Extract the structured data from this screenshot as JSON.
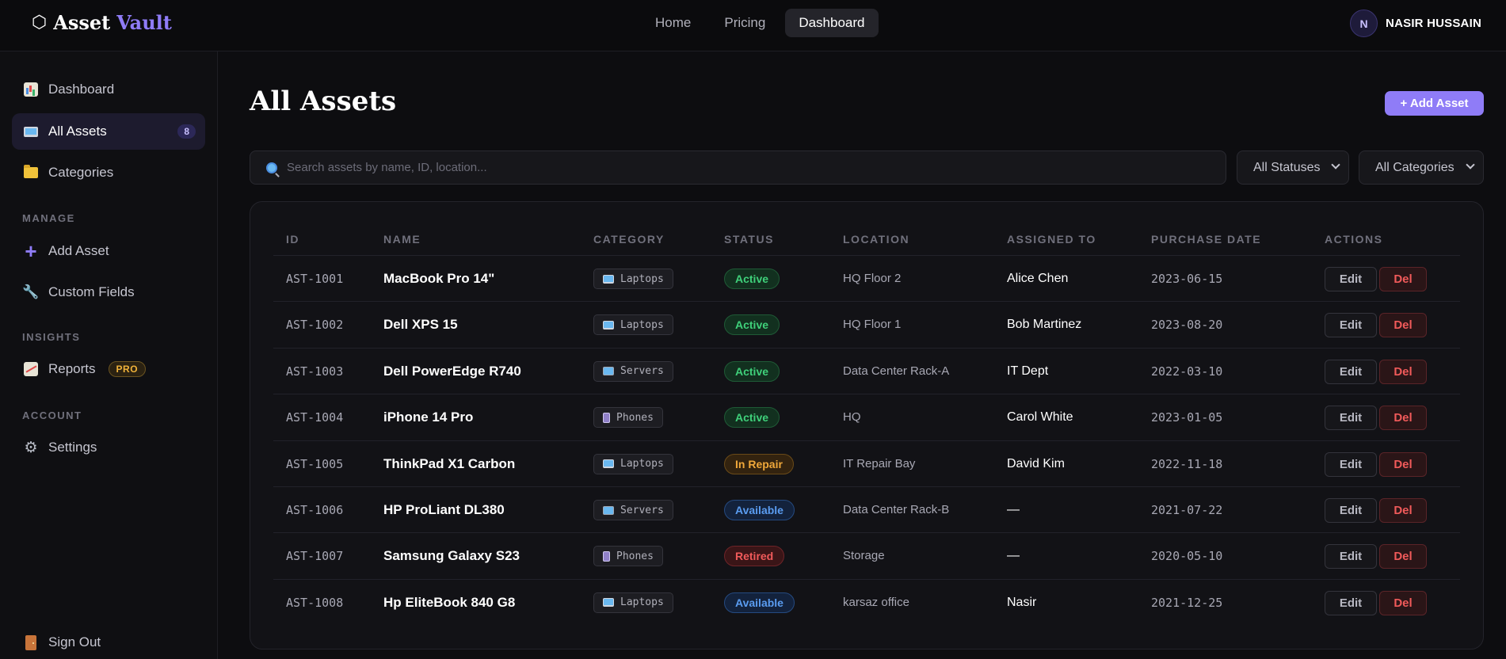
{
  "app": {
    "logo_word1": "Asset",
    "logo_word2": "Vault"
  },
  "nav": {
    "home": "Home",
    "pricing": "Pricing",
    "dashboard": "Dashboard"
  },
  "user": {
    "initial": "N",
    "name": "NASIR HUSSAIN"
  },
  "sidebar": {
    "items": [
      {
        "label": "Dashboard",
        "icon": "chart-icon"
      },
      {
        "label": "All Assets",
        "icon": "laptop-icon",
        "count": "8"
      },
      {
        "label": "Categories",
        "icon": "folder-icon"
      }
    ],
    "manage_heading": "MANAGE",
    "manage_items": [
      {
        "label": "Add Asset",
        "icon": "plus-icon"
      },
      {
        "label": "Custom Fields",
        "icon": "wrench-icon"
      }
    ],
    "insights_heading": "INSIGHTS",
    "insights_items": [
      {
        "label": "Reports",
        "icon": "trend-chart-icon",
        "badge": "PRO"
      }
    ],
    "account_heading": "ACCOUNT",
    "account_items": [
      {
        "label": "Settings",
        "icon": "gear-icon"
      }
    ],
    "sign_out": "Sign Out"
  },
  "main": {
    "title": "All Assets",
    "add_button": "+ Add Asset",
    "search_placeholder": "Search assets by name, ID, location...",
    "status_filter": "All Statuses",
    "category_filter": "All Categories"
  },
  "table": {
    "headers": [
      "ID",
      "NAME",
      "CATEGORY",
      "STATUS",
      "LOCATION",
      "ASSIGNED TO",
      "PURCHASE DATE",
      "ACTIONS"
    ],
    "edit_label": "Edit",
    "del_label": "Del",
    "rows": [
      {
        "id": "AST-1001",
        "name": "MacBook Pro 14\"",
        "category": "Laptops",
        "status": "Active",
        "location": "HQ Floor 2",
        "assigned": "Alice Chen",
        "date": "2023-06-15"
      },
      {
        "id": "AST-1002",
        "name": "Dell XPS 15",
        "category": "Laptops",
        "status": "Active",
        "location": "HQ Floor 1",
        "assigned": "Bob Martinez",
        "date": "2023-08-20"
      },
      {
        "id": "AST-1003",
        "name": "Dell PowerEdge R740",
        "category": "Servers",
        "status": "Active",
        "location": "Data Center Rack-A",
        "assigned": "IT Dept",
        "date": "2022-03-10"
      },
      {
        "id": "AST-1004",
        "name": "iPhone 14 Pro",
        "category": "Phones",
        "status": "Active",
        "location": "HQ",
        "assigned": "Carol White",
        "date": "2023-01-05"
      },
      {
        "id": "AST-1005",
        "name": "ThinkPad X1 Carbon",
        "category": "Laptops",
        "status": "In Repair",
        "location": "IT Repair Bay",
        "assigned": "David Kim",
        "date": "2022-11-18"
      },
      {
        "id": "AST-1006",
        "name": "HP ProLiant DL380",
        "category": "Servers",
        "status": "Available",
        "location": "Data Center Rack-B",
        "assigned": "—",
        "date": "2021-07-22"
      },
      {
        "id": "AST-1007",
        "name": "Samsung Galaxy S23",
        "category": "Phones",
        "status": "Retired",
        "location": "Storage",
        "assigned": "—",
        "date": "2020-05-10"
      },
      {
        "id": "AST-1008",
        "name": "Hp EliteBook 840 G8",
        "category": "Laptops",
        "status": "Available",
        "location": "karsaz office",
        "assigned": "Nasir",
        "date": "2021-12-25"
      }
    ]
  }
}
